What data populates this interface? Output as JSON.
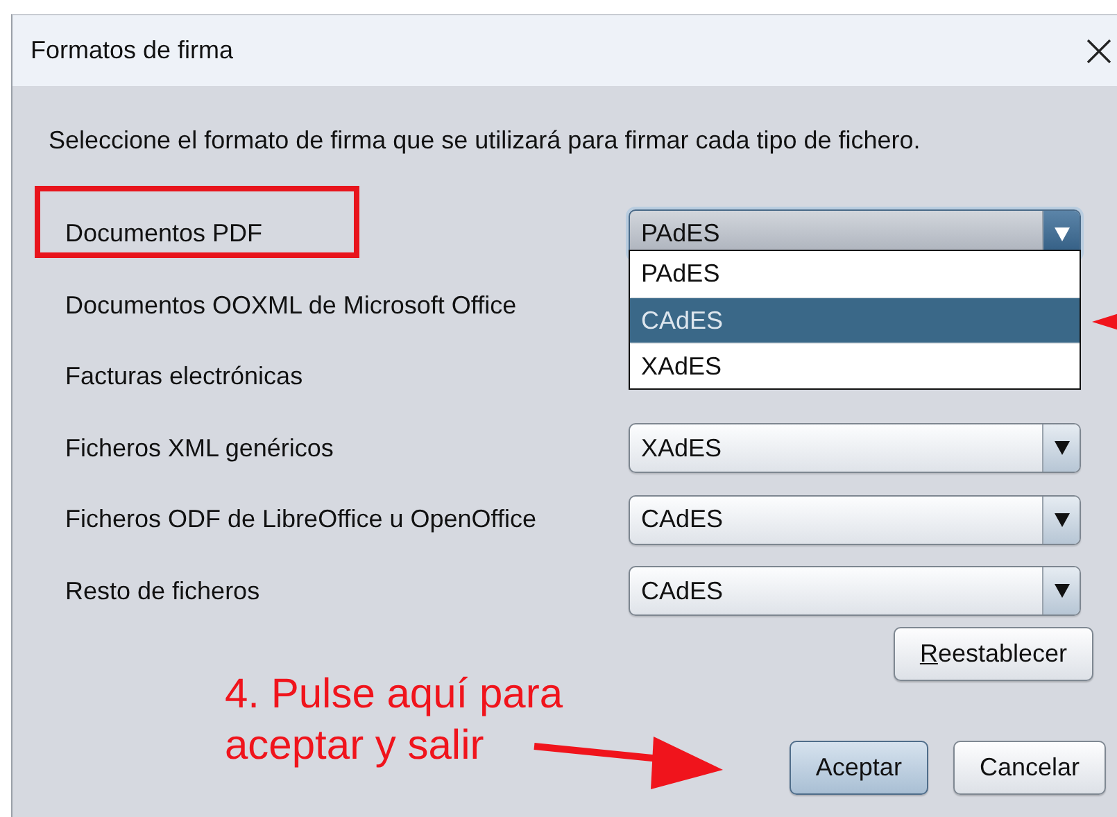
{
  "window": {
    "title": "Formatos de firma"
  },
  "instruction": "Seleccione el formato de firma que se utilizará para firmar cada tipo de fichero.",
  "rows": [
    {
      "label": "Documentos PDF",
      "value": "PAdES",
      "open": true,
      "highlighted": true
    },
    {
      "label": "Documentos OOXML de Microsoft Office",
      "highlighted": false
    },
    {
      "label": "Facturas electrónicas",
      "highlighted": false
    },
    {
      "label": "Ficheros XML genéricos",
      "value": "XAdES",
      "open": false,
      "highlighted": false
    },
    {
      "label": "Ficheros ODF de LibreOffice u OpenOffice",
      "value": "CAdES",
      "open": false,
      "highlighted": false
    },
    {
      "label": "Resto de ficheros",
      "value": "CAdES",
      "open": false,
      "highlighted": false
    }
  ],
  "dropdown": {
    "options": [
      {
        "label": "PAdES",
        "selected": false
      },
      {
        "label": "CAdES",
        "selected": true
      },
      {
        "label": "XAdES",
        "selected": false
      }
    ]
  },
  "reset_button": {
    "label": "Reestablecer"
  },
  "buttons": [
    {
      "label": "Aceptar",
      "default": true
    },
    {
      "label": "Cancelar",
      "default": false
    }
  ],
  "annotation": {
    "text": "4. Pulse aquí para\naceptar y salir"
  }
}
